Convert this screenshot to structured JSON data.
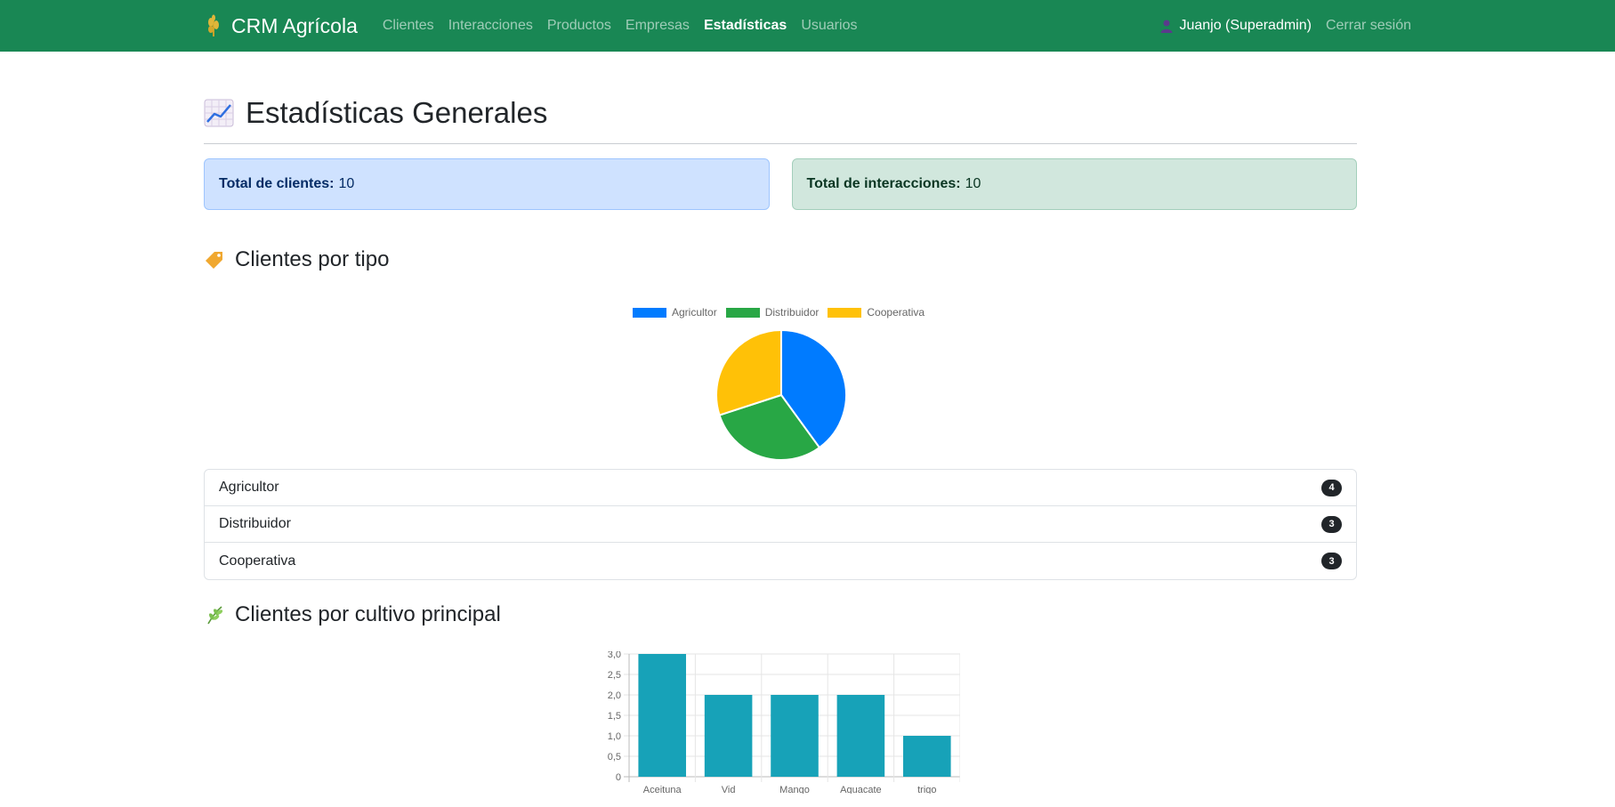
{
  "nav": {
    "brand": "CRM Agrícola",
    "links": [
      {
        "label": "Clientes",
        "active": false
      },
      {
        "label": "Interacciones",
        "active": false
      },
      {
        "label": "Productos",
        "active": false
      },
      {
        "label": "Empresas",
        "active": false
      },
      {
        "label": "Estadísticas",
        "active": true
      },
      {
        "label": "Usuarios",
        "active": false
      }
    ],
    "user": "Juanjo (Superadmin)",
    "logout": "Cerrar sesión"
  },
  "page": {
    "title": "Estadísticas Generales",
    "total_clientes_label": "Total de clientes:",
    "total_clientes_value": "10",
    "total_interacciones_label": "Total de interacciones:",
    "total_interacciones_value": "10"
  },
  "sections": {
    "por_tipo": "Clientes por tipo",
    "por_cultivo": "Clientes por cultivo principal"
  },
  "tipo_list": [
    {
      "label": "Agricultor",
      "count": "4"
    },
    {
      "label": "Distribuidor",
      "count": "3"
    },
    {
      "label": "Cooperativa",
      "count": "3"
    }
  ],
  "colors": {
    "navbar": "#198754",
    "agricultor": "#007bff",
    "distribuidor": "#28a745",
    "cooperativa": "#ffc107",
    "bar": "#17a2b8"
  },
  "chart_data": [
    {
      "type": "pie",
      "categories": [
        "Agricultor",
        "Distribuidor",
        "Cooperativa"
      ],
      "values": [
        4,
        3,
        3
      ],
      "colors": [
        "#007bff",
        "#28a745",
        "#ffc107"
      ],
      "legend": "top"
    },
    {
      "type": "bar",
      "categories": [
        "Aceituna",
        "Vid",
        "Mango",
        "Aguacate",
        "trigo"
      ],
      "values": [
        3,
        2,
        2,
        2,
        1
      ],
      "ylim": [
        0,
        3
      ],
      "yticks": [
        "0",
        "0,5",
        "1,0",
        "1,5",
        "2,0",
        "2,5",
        "3,0"
      ],
      "grid": true,
      "color": "#17a2b8"
    }
  ]
}
